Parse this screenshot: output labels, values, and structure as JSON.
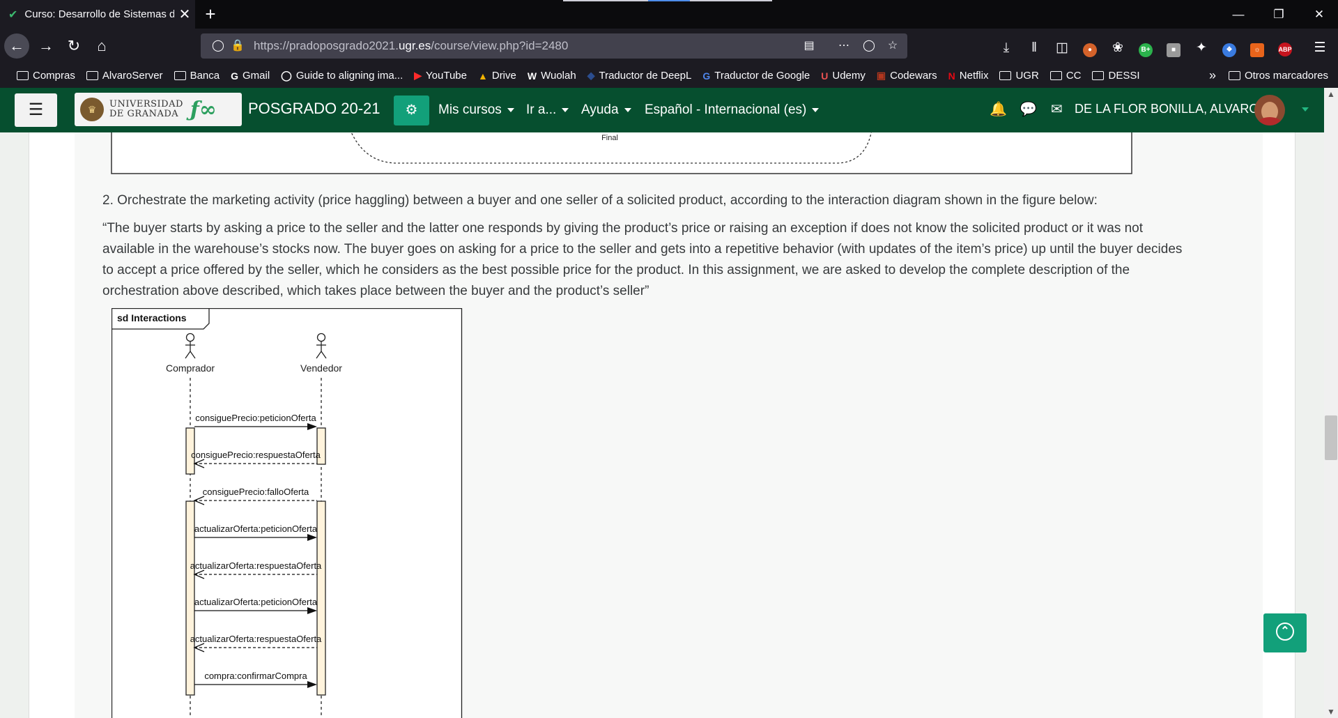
{
  "browser": {
    "tab_title": "Curso: Desarrollo de Sistemas d",
    "url_base": "https://pradoposgrado2021.",
    "url_host": "ugr.es",
    "url_path": "/course/view.php?id=2480",
    "window_controls": [
      "minimize-icon",
      "restore-icon",
      "close-icon"
    ],
    "ext_labels": {
      "bplus": "B+",
      "abp": "ABP"
    }
  },
  "bookmarks": [
    {
      "label": "Compras",
      "icon": "folder-icon"
    },
    {
      "label": "AlvaroServer",
      "icon": "folder-icon"
    },
    {
      "label": "Banca",
      "icon": "folder-icon"
    },
    {
      "label": "Gmail",
      "icon": "google-icon"
    },
    {
      "label": "Guide to aligning ima...",
      "icon": "github-icon"
    },
    {
      "label": "YouTube",
      "icon": "youtube-icon"
    },
    {
      "label": "Drive",
      "icon": "drive-icon"
    },
    {
      "label": "Wuolah",
      "icon": "wuolah-icon"
    },
    {
      "label": "Traductor de DeepL",
      "icon": "deepl-icon"
    },
    {
      "label": "Traductor de Google",
      "icon": "google-translate-icon"
    },
    {
      "label": "Udemy",
      "icon": "udemy-icon"
    },
    {
      "label": "Codewars",
      "icon": "codewars-icon"
    },
    {
      "label": "Netflix",
      "icon": "netflix-icon"
    },
    {
      "label": "UGR",
      "icon": "folder-icon"
    },
    {
      "label": "CC",
      "icon": "folder-icon"
    },
    {
      "label": "DESSI",
      "icon": "folder-icon"
    }
  ],
  "bookmarks_other": "Otros marcadores",
  "moodle": {
    "logo_line1": "UNIVERSIDAD",
    "logo_line2": "DE GRANADA",
    "site_name": "POSGRADO 20-21",
    "menus": [
      "Mis cursos",
      "Ir a...",
      "Ayuda",
      "Español - Internacional (es)"
    ],
    "user_name": "DE LA FLOR BONILLA, ALVARO"
  },
  "content": {
    "top_figure_label": "Final",
    "question": "2. Orchestrate the marketing activity (price haggling) between a buyer and one seller of a solicited product, according to the interaction diagram shown in the figure below:",
    "quote_lines": [
      "“The buyer starts by asking a price to the seller and the latter one responds by giving the product’s price or raising an exception if does not know the solicited product or it was not",
      "available in the warehouse’s stocks now. The buyer goes on asking for a price to the seller and gets into a repetitive behavior (with updates of the item’s price) up until the buyer decides",
      "to accept a price offered by the seller, which he considers as the best possible price for the product. In this assignment, we are asked to develop the complete description of the",
      "orchestration above described, which takes place between the buyer and the product’s seller”"
    ]
  },
  "diagram": {
    "frame_label": "sd Interactions",
    "actors": [
      "Comprador",
      "Vendedor"
    ],
    "messages": [
      {
        "label": "consiguePrecio:peticionOferta",
        "dir": "right",
        "kind": "sync"
      },
      {
        "label": "consiguePrecio:respuestaOferta",
        "dir": "left",
        "kind": "reply"
      },
      {
        "label": "consiguePrecio:falloOferta",
        "dir": "left",
        "kind": "reply"
      },
      {
        "label": "actualizarOferta:peticionOferta",
        "dir": "right",
        "kind": "sync"
      },
      {
        "label": "actualizarOferta:respuestaOferta",
        "dir": "left",
        "kind": "reply"
      },
      {
        "label": "actualizarOferta:peticionOferta",
        "dir": "right",
        "kind": "sync"
      },
      {
        "label": "actualizarOferta:respuestaOferta",
        "dir": "left",
        "kind": "reply"
      },
      {
        "label": "compra:confirmarCompra",
        "dir": "right",
        "kind": "sync"
      }
    ]
  },
  "colors": {
    "moodle_header": "#064f2f",
    "accent": "#12a07a",
    "browser_dark": "#1c1b22"
  }
}
